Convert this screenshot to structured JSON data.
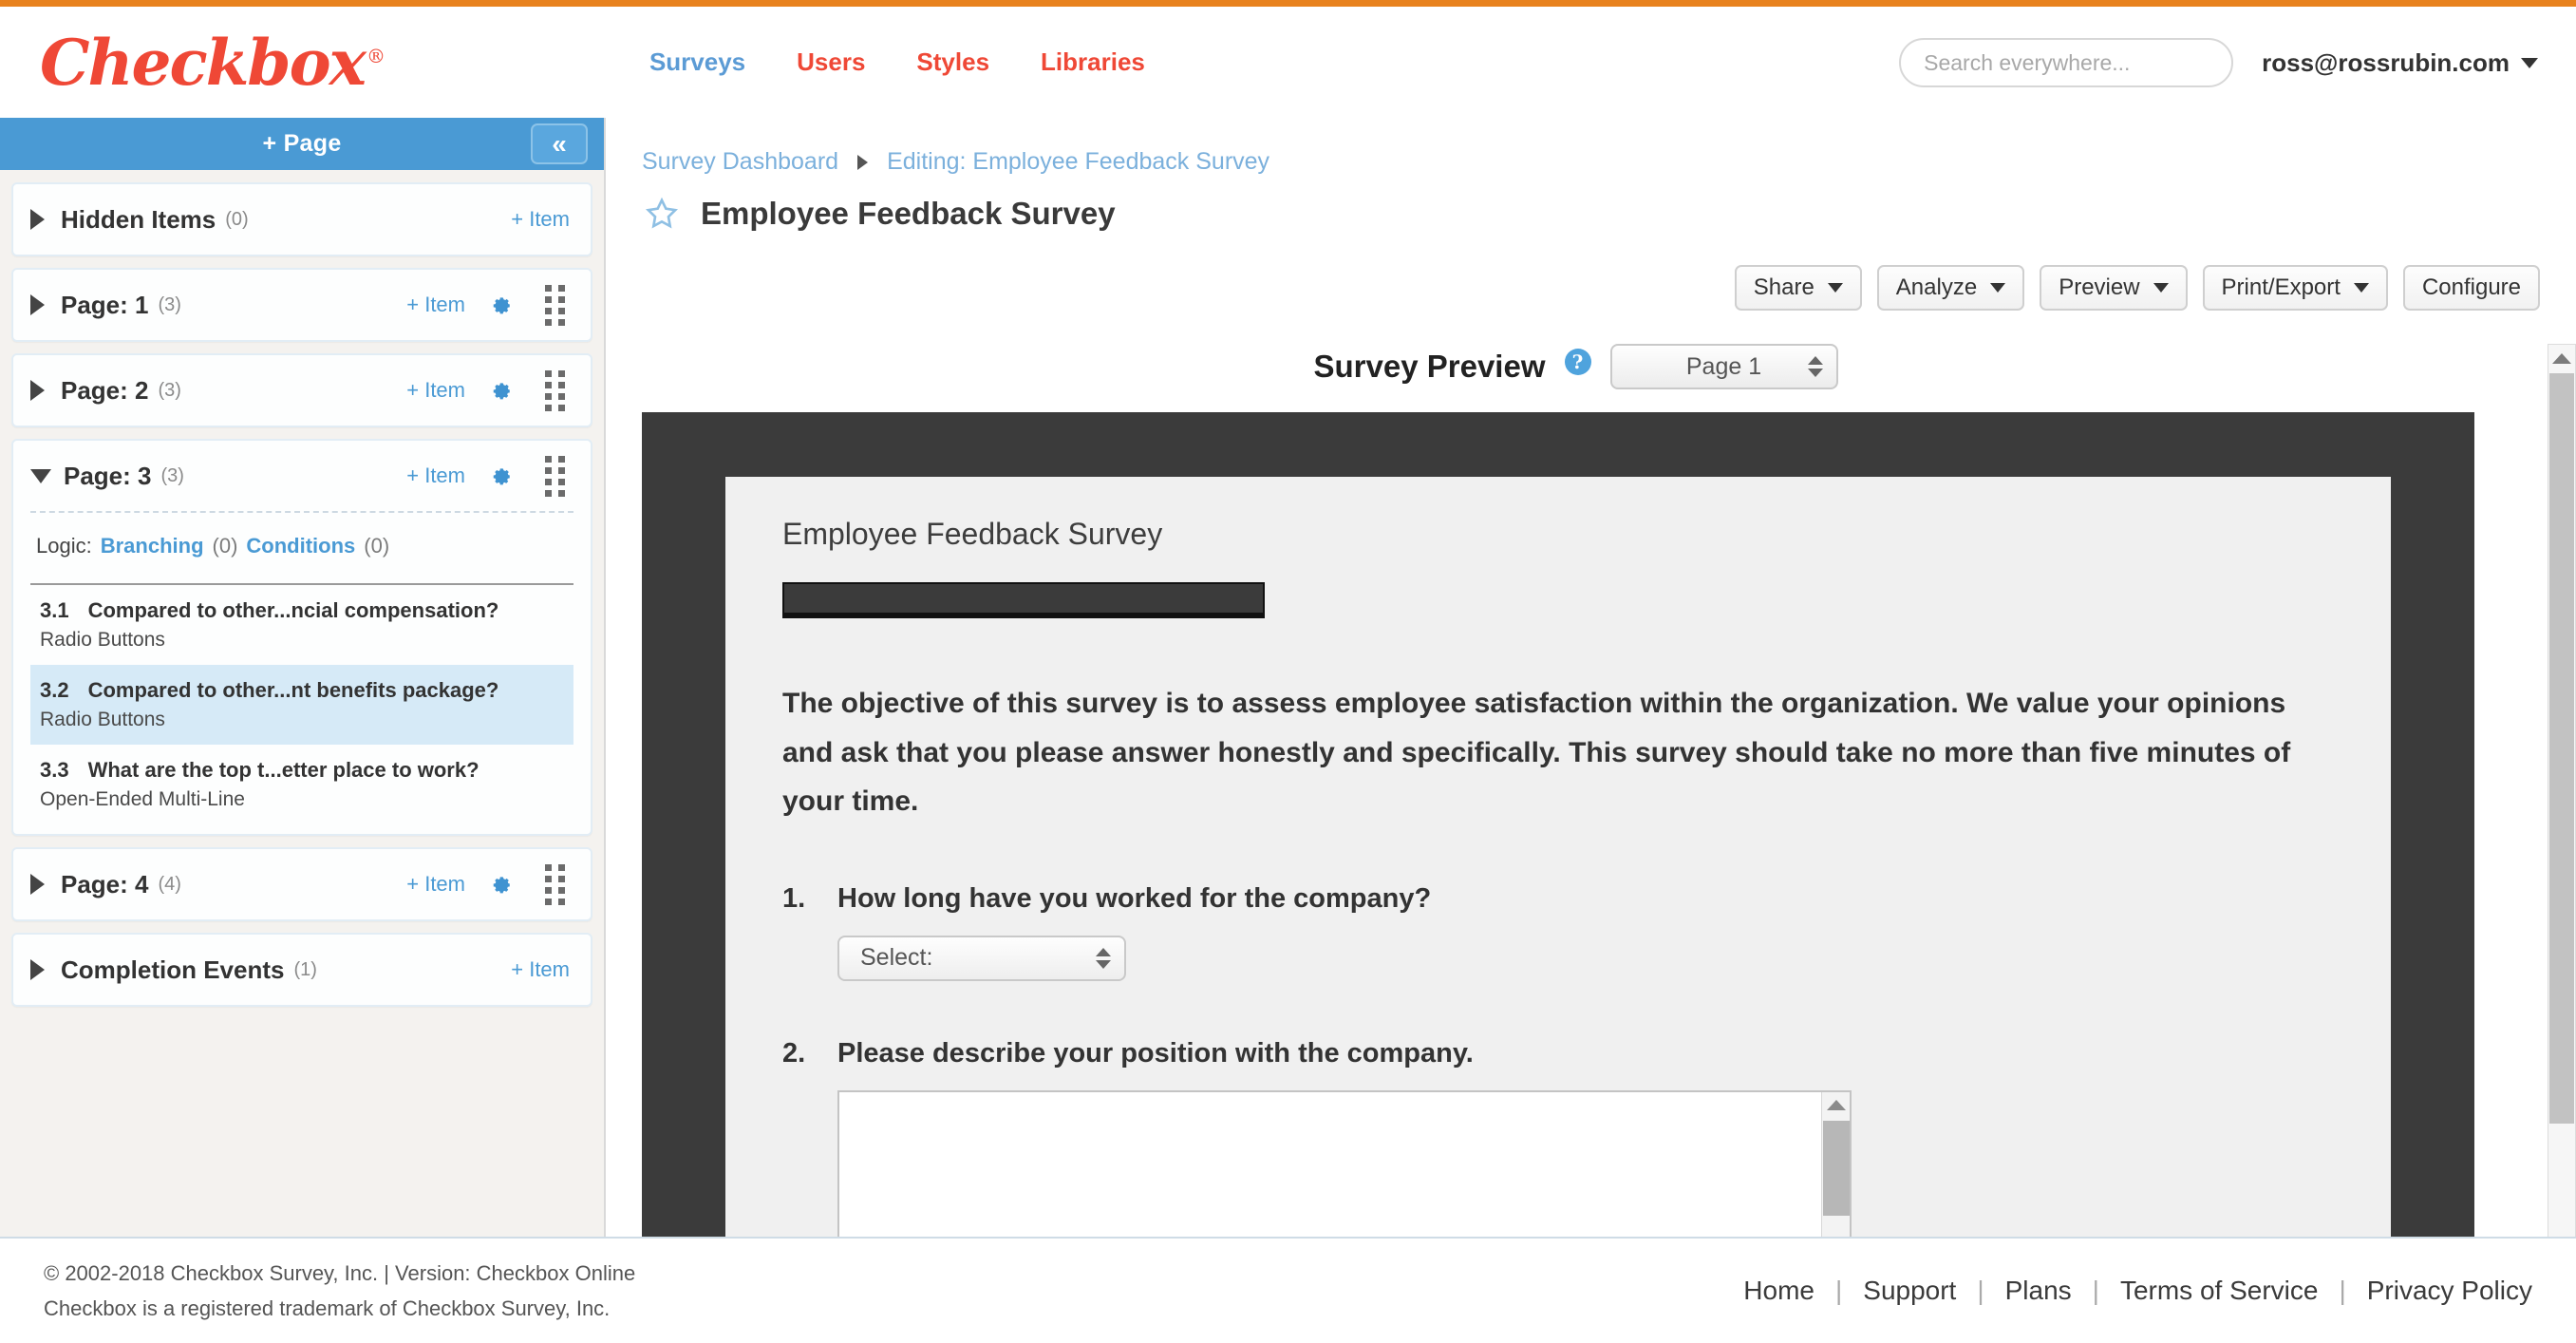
{
  "brand": {
    "name": "Checkbox",
    "registered": "®",
    "color": "#ef4836"
  },
  "nav": [
    {
      "label": "Surveys",
      "active": true
    },
    {
      "label": "Users",
      "active": false
    },
    {
      "label": "Styles",
      "active": false
    },
    {
      "label": "Libraries",
      "active": false
    }
  ],
  "search": {
    "placeholder": "Search everywhere...",
    "value": ""
  },
  "account": {
    "email": "ross@rossrubin.com"
  },
  "sidebar": {
    "add_page_label": "+ Page",
    "collapse_label": "«",
    "cards": [
      {
        "title": "Hidden Items",
        "count": "(0)",
        "add_item": "+ Item",
        "has_gear": false,
        "has_drag": false,
        "expanded": false
      },
      {
        "title": "Page: 1",
        "count": "(3)",
        "add_item": "+ Item",
        "has_gear": true,
        "has_drag": true,
        "expanded": false
      },
      {
        "title": "Page: 2",
        "count": "(3)",
        "add_item": "+ Item",
        "has_gear": true,
        "has_drag": true,
        "expanded": false
      },
      {
        "title": "Page: 3",
        "count": "(3)",
        "add_item": "+ Item",
        "has_gear": true,
        "has_drag": true,
        "expanded": true
      },
      {
        "title": "Page: 4",
        "count": "(4)",
        "add_item": "+ Item",
        "has_gear": true,
        "has_drag": true,
        "expanded": false
      },
      {
        "title": "Completion Events",
        "count": "(1)",
        "add_item": "+ Item",
        "has_gear": false,
        "has_drag": false,
        "expanded": false
      }
    ],
    "page3": {
      "logic_label": "Logic:",
      "branching_label": "Branching",
      "branching_count": "(0)",
      "conditions_label": "Conditions",
      "conditions_count": "(0)",
      "items": [
        {
          "num": "3.1",
          "text": "Compared to other...ncial compensation?",
          "type": "Radio Buttons",
          "selected": false
        },
        {
          "num": "3.2",
          "text": "Compared to other...nt benefits package?",
          "type": "Radio Buttons",
          "selected": true
        },
        {
          "num": "3.3",
          "text": "What are the top t...etter place to work?",
          "type": "Open-Ended Multi-Line",
          "selected": false
        }
      ]
    }
  },
  "breadcrumb": {
    "root": "Survey Dashboard",
    "current": "Editing: Employee Feedback Survey"
  },
  "page_title": "Employee Feedback Survey",
  "toolbar": [
    {
      "label": "Share",
      "has_arrow": true
    },
    {
      "label": "Analyze",
      "has_arrow": true
    },
    {
      "label": "Preview",
      "has_arrow": true
    },
    {
      "label": "Print/Export",
      "has_arrow": true
    },
    {
      "label": "Configure",
      "has_arrow": false
    }
  ],
  "preview": {
    "heading": "Survey Preview",
    "help": "?",
    "page_selector": "Page 1",
    "survey_title": "Employee Feedback Survey",
    "intro": "The objective of this survey is to assess employee satisfaction within the organization. We value your opinions and ask that you please answer honestly and specifically. This survey should take no more than five minutes of your time.",
    "questions": [
      {
        "num": "1.",
        "text": "How long have you worked for the company?",
        "control": "select",
        "value": "Select:"
      },
      {
        "num": "2.",
        "text": "Please describe your position with the company.",
        "control": "textarea",
        "value": ""
      }
    ]
  },
  "footer": {
    "copyright": "© 2002-2018 Checkbox Survey, Inc. | Version: Checkbox Online",
    "trademark": "Checkbox is a registered trademark of Checkbox Survey, Inc.",
    "links": [
      "Home",
      "Support",
      "Plans",
      "Terms of Service",
      "Privacy Policy"
    ]
  }
}
